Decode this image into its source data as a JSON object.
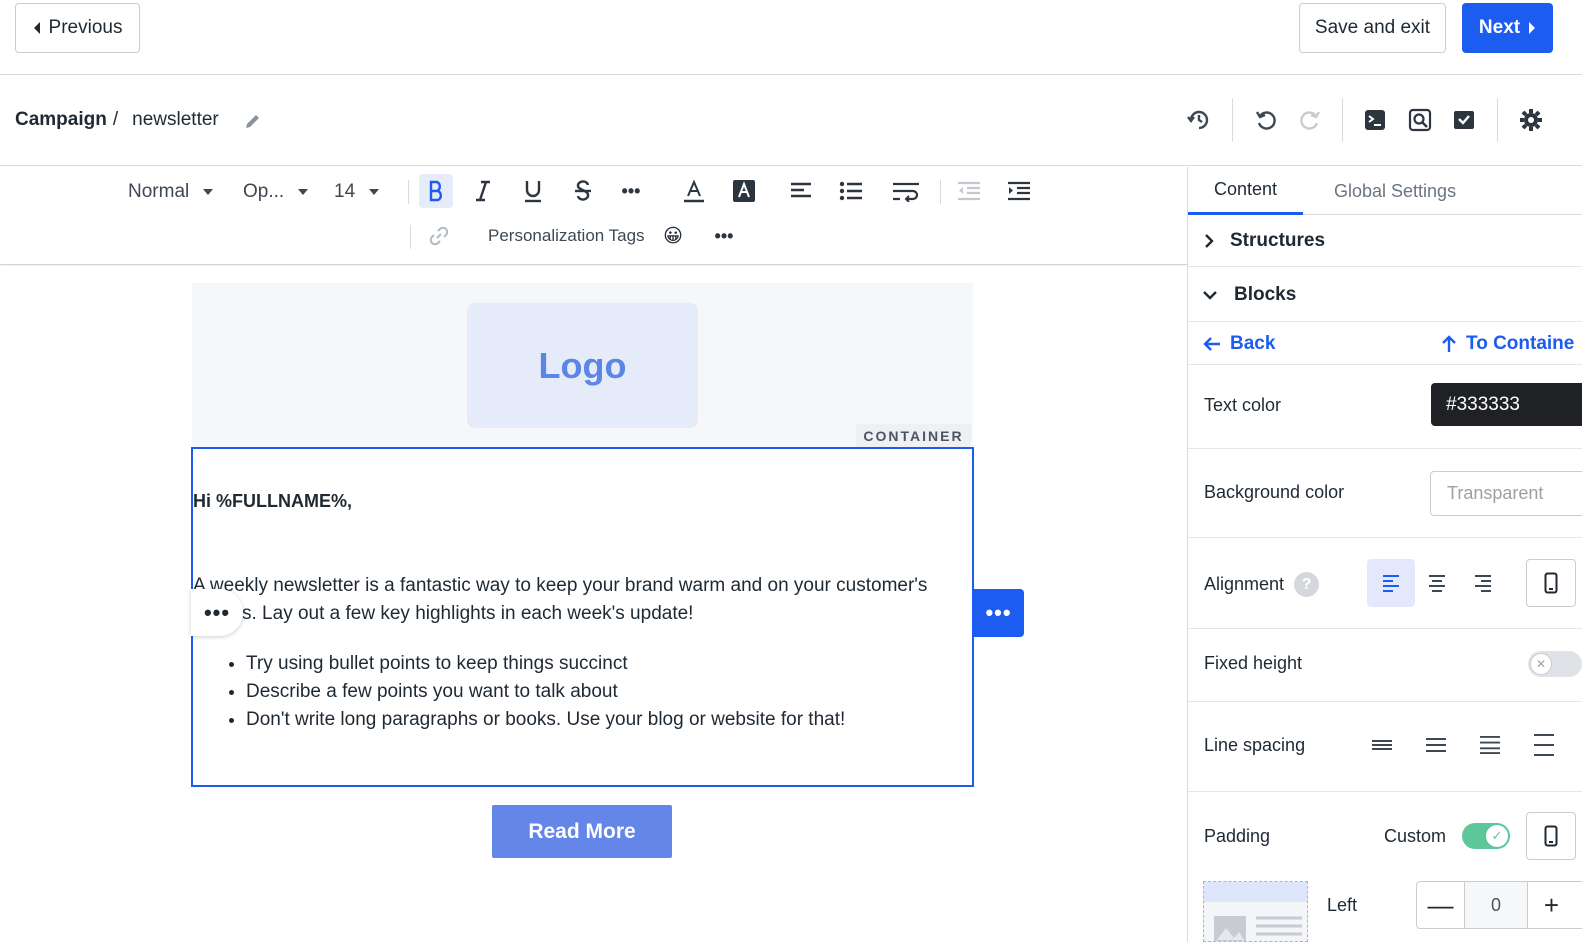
{
  "topbar": {
    "previous_label": "Previous",
    "save_exit_label": "Save and exit",
    "next_label": "Next"
  },
  "breadcrumb": {
    "root": "Campaign",
    "separator": "/",
    "current": "newsletter"
  },
  "toolbar": {
    "format_select": "Normal",
    "font_select": "Op...",
    "size_select": "14",
    "personalization_label": "Personalization Tags",
    "emoji": "😀",
    "more": "•••"
  },
  "canvas": {
    "logo_text": "Logo",
    "container_tag": "CONTAINER",
    "greeting": "Hi %FULLNAME%,",
    "paragraph_line1": "A weekly newsletter is a fantastic way to keep your brand warm and on your customer's",
    "paragraph_line2": "s. Lay out a few key highlights in each week's update!",
    "bullets": [
      "Try using bullet points to keep things succinct",
      "Describe a few points you want to talk about",
      "Don't write long paragraphs or books. Use your blog or website for that!"
    ],
    "block_menu": "•••",
    "read_more_label": "Read More"
  },
  "panel": {
    "tabs": [
      {
        "label": "Content",
        "active": true
      },
      {
        "label": "Global Settings",
        "active": false
      }
    ],
    "structures_label": "Structures",
    "blocks_label": "Blocks",
    "back_label": "Back",
    "to_container_label": "To Containe",
    "text_color_label": "Text color",
    "text_color_value": "#333333",
    "bg_color_label": "Background color",
    "bg_color_placeholder": "Transparent",
    "alignment_label": "Alignment",
    "alignment_help": "?",
    "fixed_height_label": "Fixed height",
    "fixed_height_on": false,
    "line_spacing_label": "Line spacing",
    "padding_label": "Padding",
    "padding_mode": "Custom",
    "padding_custom_on": true,
    "left_label": "Left",
    "left_value": "0",
    "minus": "—",
    "plus": "+"
  },
  "colors": {
    "primary": "#1c5cf0",
    "read_more": "#6386e8",
    "toggle_on": "#5ec79a"
  }
}
